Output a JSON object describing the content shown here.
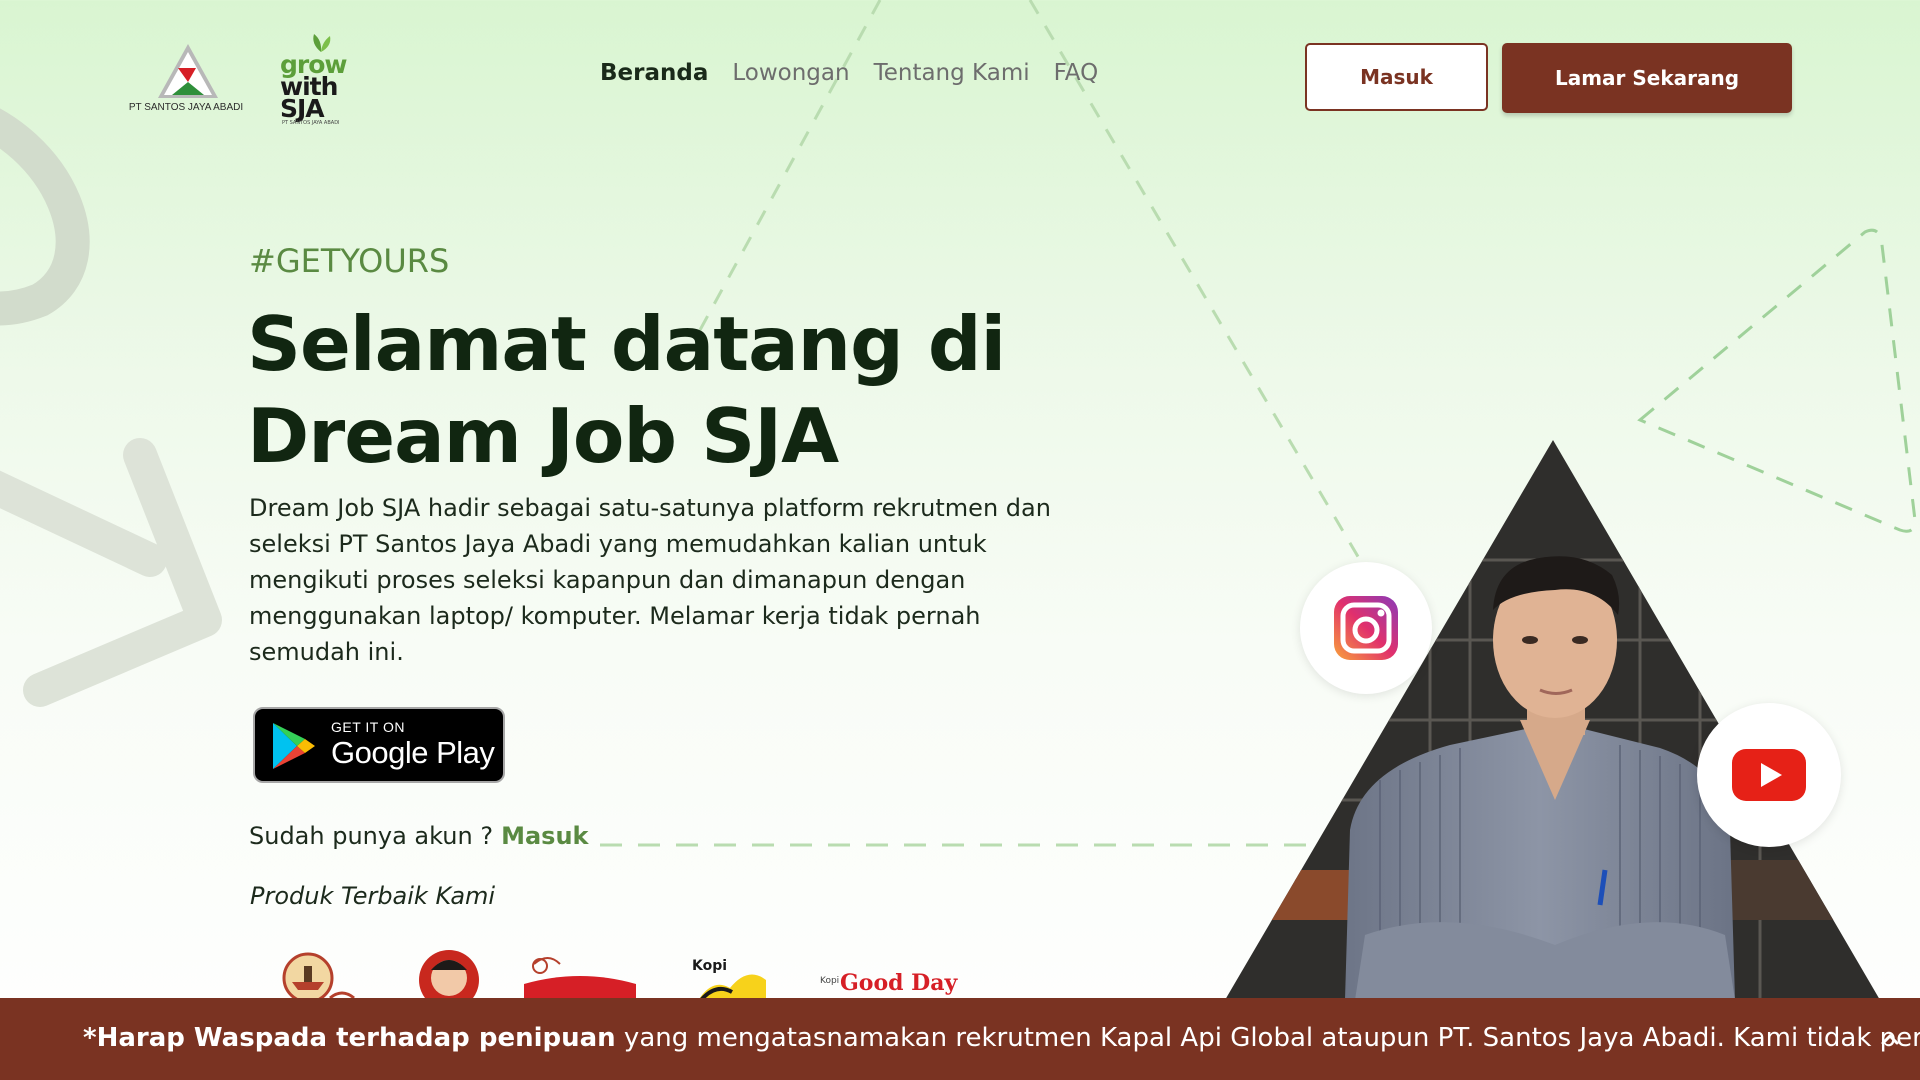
{
  "header": {
    "logo_company_text": "PT SANTOS JAYA ABADI",
    "logo_grow": [
      "grow",
      "with",
      "SJA"
    ],
    "logo_grow_sub": "PT SANTOS JAYA ABADI",
    "nav": [
      {
        "label": "Beranda",
        "active": true
      },
      {
        "label": "Lowongan",
        "active": false
      },
      {
        "label": "Tentang Kami",
        "active": false
      },
      {
        "label": "FAQ",
        "active": false
      }
    ],
    "login_label": "Masuk",
    "apply_label": "Lamar Sekarang"
  },
  "hero": {
    "hashtag": "#GETYOURS",
    "headline_line1": "Selamat datang di",
    "headline_line2": "Dream Job SJA",
    "description": "Dream Job SJA hadir sebagai satu-satunya platform rekrutmen dan seleksi PT Santos Jaya Abadi yang memudahkan kalian untuk mengikuti proses seleksi kapanpun dan dimanapun dengan menggunakan laptop/ komputer. Melamar kerja tidak pernah semudah ini.",
    "google_play_small": "GET IT ON",
    "google_play_big": "Google Play",
    "account_question": "Sudah punya akun ?",
    "account_link": "Masuk",
    "products_label": "Produk Terbaik Kami",
    "brands": [
      "Kapal Api",
      "ABC",
      "Excelso",
      "Kopi Ya!",
      "Good Day"
    ],
    "brand_kopi_label": "Kopi",
    "brand_goodday_label": "Good Day"
  },
  "social": {
    "icons": [
      "instagram-icon",
      "youtube-icon"
    ]
  },
  "warning_bar": {
    "bold": "*Harap Waspada terhadap penipuan",
    "rest": " yang mengatasnamakan rekrutmen Kapal Api Global ataupun PT. Santos Jaya Abadi. Kami tidak pernah"
  },
  "colors": {
    "brand_brown": "#7a3322",
    "accent_green": "#5a8a42",
    "heading_dark": "#112611"
  }
}
